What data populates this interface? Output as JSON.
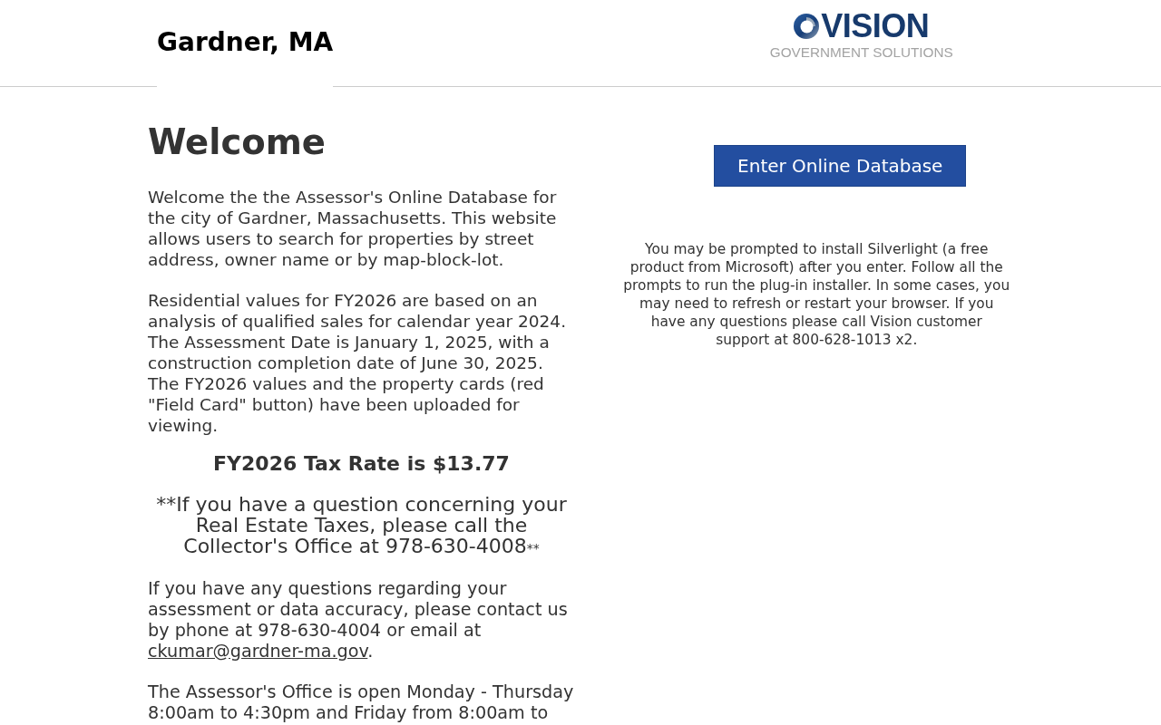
{
  "header": {
    "title": "Gardner, MA",
    "logo": {
      "wordmark": "VISION",
      "tagline": "GOVERNMENT SOLUTIONS"
    }
  },
  "main": {
    "heading": "Welcome",
    "blocks": [
      {
        "kind": "paragraph",
        "text": "Welcome the the Assessor's Online Database for the city of Gardner, Massachusetts. This website allows users to search for properties by street address, owner name or by map-block-lot."
      },
      {
        "kind": "paragraph",
        "text": "Residential values for FY2026 are based on an analysis of qualified sales for calendar year 2024. The Assessment Date is January 1, 2025, with a construction completion date of June 30, 2025. The FY2026 values and the property cards (red \"Field Card\" button) have been uploaded for viewing."
      },
      {
        "kind": "highlight",
        "text": "FY2026 Tax Rate is $13.77"
      },
      {
        "kind": "notice",
        "text": "**If you have a question concerning your Real Estate Taxes, please call the Collector's Office at 978-630-4008",
        "suffix": "**"
      },
      {
        "kind": "contact",
        "text": "If you have any questions regarding your assessment or data accuracy, please contact us by phone at 978-630-4004 or email at",
        "link": "ckumar@gardner-ma.gov",
        "after": "."
      },
      {
        "kind": "info",
        "text": "The Assessor's Office is open Monday - Thursday 8:00am to 4:30pm and Friday from 8:00am to"
      }
    ]
  },
  "database": {
    "button": "Enter Online Database",
    "note": "You may be prompted to install Silverlight (a free product from Microsoft) after you enter. Follow all the prompts to run the plug-in installer. In some cases, you may need to refresh or restart your browser. If you have any questions please call Vision customer support at 800-628-1013 x2."
  }
}
